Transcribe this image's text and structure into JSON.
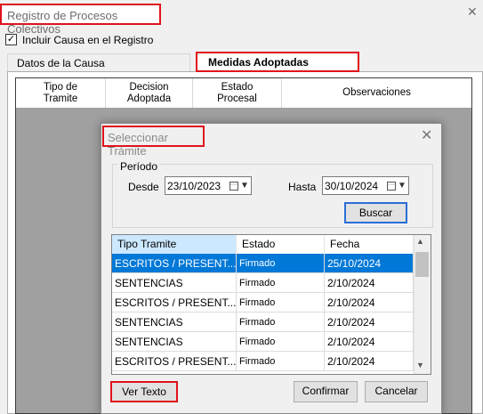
{
  "window": {
    "title": "Registro de Procesos Colectivos",
    "close_glyph": "✕",
    "include_cause_checked": true,
    "include_cause_label": "Incluir Causa en el Registro",
    "tabs": [
      {
        "label": "Datos de la Causa"
      },
      {
        "label": "Medidas Adoptadas"
      }
    ],
    "grid_headers": [
      "Tipo de\nTramite",
      "Decision\nAdoptada",
      "Estado\nProcesal",
      "Observaciones"
    ]
  },
  "dialog": {
    "title": "Seleccionar Trámite",
    "close_glyph": "✕",
    "period_label": "Período",
    "from_label": "Desde",
    "from_date": "23/10/2023",
    "to_label": "Hasta",
    "to_date": "30/10/2024",
    "search_label": "Buscar",
    "columns": [
      "Tipo Tramite",
      "Estado",
      "Fecha"
    ],
    "rows": [
      [
        "ESCRITOS / PRESENT...",
        "Firmado",
        "25/10/2024"
      ],
      [
        "SENTENCIAS",
        "Firmado",
        "2/10/2024"
      ],
      [
        "ESCRITOS / PRESENT...",
        "Firmado",
        "2/10/2024"
      ],
      [
        "SENTENCIAS",
        "Firmado",
        "2/10/2024"
      ],
      [
        "SENTENCIAS",
        "Firmado",
        "2/10/2024"
      ],
      [
        "ESCRITOS / PRESENT...",
        "Firmado",
        "2/10/2024"
      ]
    ],
    "selected_row": 0,
    "view_text_label": "Ver Texto",
    "confirm_label": "Confirmar",
    "cancel_label": "Cancelar"
  },
  "colors": {
    "highlight_box": "#e0121b",
    "selection": "#0078d7",
    "primary_button_border": "#2b6ed7",
    "grid_background": "#a0a0a0"
  }
}
